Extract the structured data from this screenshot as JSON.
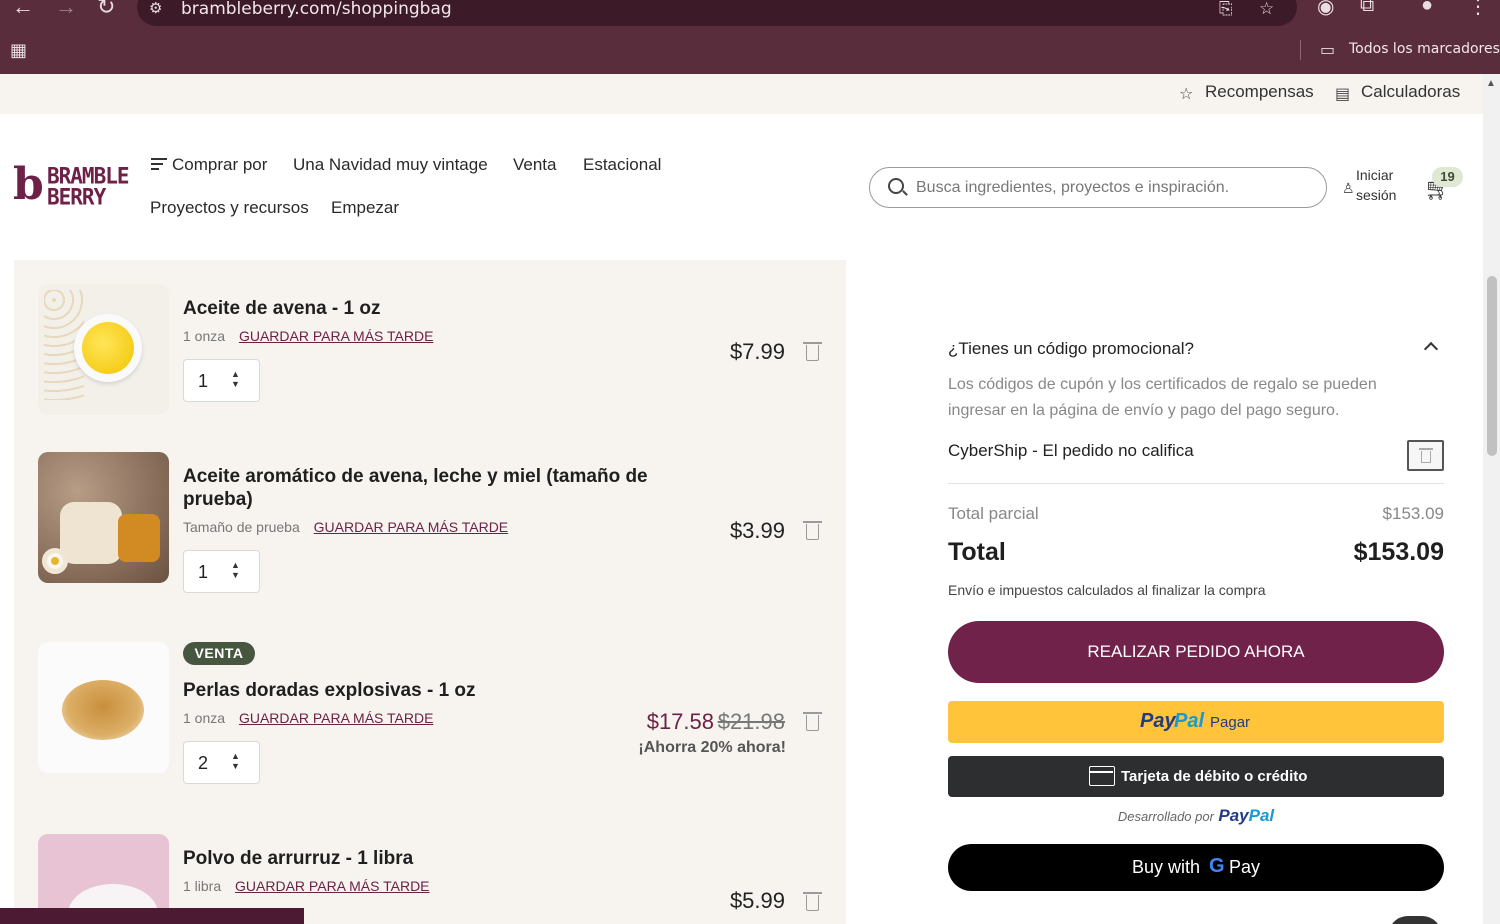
{
  "browser": {
    "url": "brambleberry.com/shoppingbag",
    "bookmarks_folder": "Todos los marcadores",
    "icons": [
      "back-icon",
      "forward-icon",
      "reload-icon",
      "site-info-icon",
      "translate-icon",
      "bookmark-star-icon",
      "extension-icon",
      "puzzle-icon",
      "profile-icon",
      "menu-dots-icon",
      "apps-grid-icon",
      "folder-icon"
    ],
    "theme_color": "#5a2d3c"
  },
  "utility": {
    "rewards": "Recompensas",
    "calculators": "Calculadoras"
  },
  "header": {
    "logo_line1": "BRAMBLE",
    "logo_line2": "BERRY",
    "logo_mark": "b",
    "nav": {
      "shop_by": "Comprar por",
      "vintage": "Una Navidad muy vintage",
      "sale": "Venta",
      "seasonal": "Estacional",
      "projects": "Proyectos y recursos",
      "start": "Empezar"
    },
    "search_placeholder": "Busca ingredientes, proyectos e inspiración.",
    "signin_line1": "Iniciar",
    "signin_line2": "sesión",
    "cart_count": "19",
    "brand_color": "#6d2146"
  },
  "cart": {
    "save_label": "GUARDAR PARA MÁS TARDE",
    "items": [
      {
        "title": "Aceite de avena - 1 oz",
        "variant": "1 onza",
        "qty": "1",
        "price": "$7.99"
      },
      {
        "title": "Aceite aromático de avena, leche y miel (tamaño de prueba)",
        "variant": "Tamaño de prueba",
        "qty": "1",
        "price": "$3.99"
      },
      {
        "badge": "VENTA",
        "title": "Perlas doradas explosivas - 1 oz",
        "variant": "1 onza",
        "qty": "2",
        "price": "$17.58",
        "old_price": "$21.98",
        "savings": "¡Ahorra 20% ahora!"
      },
      {
        "title": "Polvo de arrurruz - 1 libra",
        "variant": "1 libra",
        "price": "$5.99"
      }
    ]
  },
  "summary": {
    "promo_title": "¿Tienes un código promocional?",
    "promo_text": "Los códigos de cupón y los certificados de regalo se pueden ingresar en la página de envío y pago del pago seguro.",
    "coupon": "CyberShip - El pedido no califica",
    "subtotal_label": "Total parcial",
    "subtotal": "$153.09",
    "total_label": "Total",
    "total": "$153.09",
    "shipping_note": "Envío e impuestos calculados al finalizar la compra",
    "checkout": "REALIZAR PEDIDO AHORA",
    "paypal_a": "Pay",
    "paypal_b": "Pal",
    "paypal_label": "Pagar",
    "card_label": "Tarjeta de débito o crédito",
    "powered_by": "Desarrollado por",
    "gpay_buy": "Buy with",
    "gpay_g": "G",
    "gpay_pay": "Pay"
  }
}
